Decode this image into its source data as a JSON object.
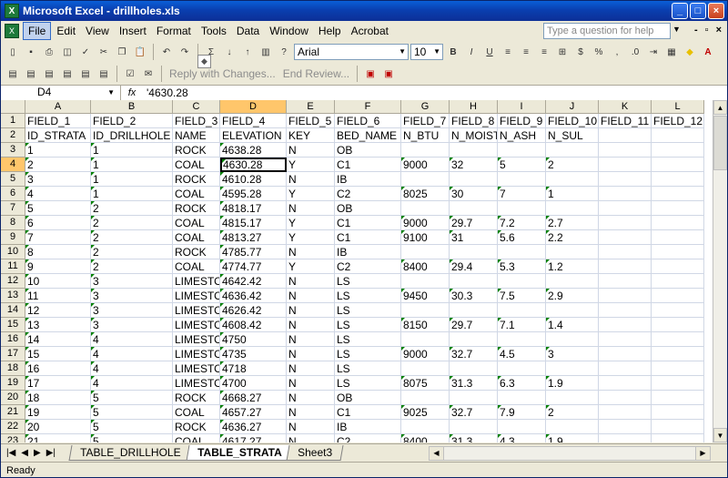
{
  "title": "Microsoft Excel - drillholes.xls",
  "menu": [
    "File",
    "Edit",
    "View",
    "Insert",
    "Format",
    "Tools",
    "Data",
    "Window",
    "Help",
    "Acrobat"
  ],
  "help_placeholder": "Type a question for help",
  "font_name": "Arial",
  "font_size": "10",
  "reply_text": "Reply with Changes...",
  "end_review_text": "End Review...",
  "name_box": "D4",
  "fx": "fx",
  "formula": "'4630.28",
  "columns": [
    "A",
    "B",
    "C",
    "D",
    "E",
    "F",
    "G",
    "H",
    "I",
    "J",
    "K",
    "L"
  ],
  "rows": [
    [
      "FIELD_1",
      "FIELD_2",
      "FIELD_3",
      "FIELD_4",
      "FIELD_5",
      "FIELD_6",
      "FIELD_7",
      "FIELD_8",
      "FIELD_9",
      "FIELD_10",
      "FIELD_11",
      "FIELD_12"
    ],
    [
      "ID_STRATA",
      "ID_DRILLHOLE",
      "NAME",
      "ELEVATION",
      "KEY",
      "BED_NAME",
      "N_BTU",
      "N_MOIST",
      "N_ASH",
      "N_SUL",
      "",
      ""
    ],
    [
      "1",
      "1",
      "ROCK",
      "4638.28",
      "N",
      "OB",
      "",
      "",
      "",
      "",
      "",
      ""
    ],
    [
      "2",
      "1",
      "COAL",
      "4630.28",
      "Y",
      "C1",
      "9000",
      "32",
      "5",
      "2",
      "",
      ""
    ],
    [
      "3",
      "1",
      "ROCK",
      "4610.28",
      "N",
      "IB",
      "",
      "",
      "",
      "",
      "",
      ""
    ],
    [
      "4",
      "1",
      "COAL",
      "4595.28",
      "Y",
      "C2",
      "8025",
      "30",
      "7",
      "1",
      "",
      ""
    ],
    [
      "5",
      "2",
      "ROCK",
      "4818.17",
      "N",
      "OB",
      "",
      "",
      "",
      "",
      "",
      ""
    ],
    [
      "6",
      "2",
      "COAL",
      "4815.17",
      "Y",
      "C1",
      "9000",
      "29.7",
      "7.2",
      "2.7",
      "",
      ""
    ],
    [
      "7",
      "2",
      "COAL",
      "4813.27",
      "Y",
      "C1",
      "9100",
      "31",
      "5.6",
      "2.2",
      "",
      ""
    ],
    [
      "8",
      "2",
      "ROCK",
      "4785.77",
      "N",
      "IB",
      "",
      "",
      "",
      "",
      "",
      ""
    ],
    [
      "9",
      "2",
      "COAL",
      "4774.77",
      "Y",
      "C2",
      "8400",
      "29.4",
      "5.3",
      "1.2",
      "",
      ""
    ],
    [
      "10",
      "3",
      "LIMESTO",
      "4642.42",
      "N",
      "LS",
      "",
      "",
      "",
      "",
      "",
      ""
    ],
    [
      "11",
      "3",
      "LIMESTO",
      "4636.42",
      "N",
      "LS",
      "9450",
      "30.3",
      "7.5",
      "2.9",
      "",
      ""
    ],
    [
      "12",
      "3",
      "LIMESTO",
      "4626.42",
      "N",
      "LS",
      "",
      "",
      "",
      "",
      "",
      ""
    ],
    [
      "13",
      "3",
      "LIMESTO",
      "4608.42",
      "N",
      "LS",
      "8150",
      "29.7",
      "7.1",
      "1.4",
      "",
      ""
    ],
    [
      "14",
      "4",
      "LIMESTO",
      "4750",
      "N",
      "LS",
      "",
      "",
      "",
      "",
      "",
      ""
    ],
    [
      "15",
      "4",
      "LIMESTO",
      "4735",
      "N",
      "LS",
      "9000",
      "32.7",
      "4.5",
      "3",
      "",
      ""
    ],
    [
      "16",
      "4",
      "LIMESTO",
      "4718",
      "N",
      "LS",
      "",
      "",
      "",
      "",
      "",
      ""
    ],
    [
      "17",
      "4",
      "LIMESTO",
      "4700",
      "N",
      "LS",
      "8075",
      "31.3",
      "6.3",
      "1.9",
      "",
      ""
    ],
    [
      "18",
      "5",
      "ROCK",
      "4668.27",
      "N",
      "OB",
      "",
      "",
      "",
      "",
      "",
      ""
    ],
    [
      "19",
      "5",
      "COAL",
      "4657.27",
      "N",
      "C1",
      "9025",
      "32.7",
      "7.9",
      "2",
      "",
      ""
    ],
    [
      "20",
      "5",
      "ROCK",
      "4636.27",
      "N",
      "IB",
      "",
      "",
      "",
      "",
      "",
      ""
    ],
    [
      "21",
      "5",
      "COAL",
      "4617.27",
      "N",
      "C2",
      "8400",
      "31.3",
      "4.3",
      "1.9",
      "",
      ""
    ]
  ],
  "tabs": [
    "TABLE_DRILLHOLE",
    "TABLE_STRATA",
    "Sheet3"
  ],
  "active_tab": "TABLE_STRATA",
  "status": "Ready"
}
